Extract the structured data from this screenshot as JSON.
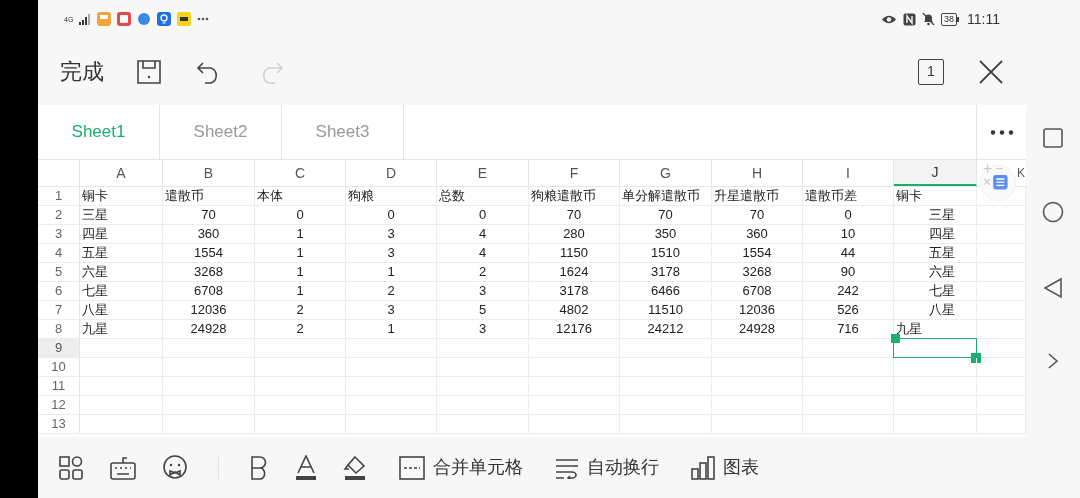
{
  "status_bar": {
    "network": "4G",
    "battery": "38",
    "time": "11:11"
  },
  "toolbar": {
    "done": "完成",
    "sheet_count": "1",
    "redo_disabled": true
  },
  "sheet_tabs": [
    {
      "label": "Sheet1",
      "selected": true
    },
    {
      "label": "Sheet2",
      "selected": false
    },
    {
      "label": "Sheet3",
      "selected": false
    }
  ],
  "columns": [
    {
      "label": "A",
      "selected": false
    },
    {
      "label": "B",
      "selected": false
    },
    {
      "label": "C",
      "selected": false
    },
    {
      "label": "D",
      "selected": false
    },
    {
      "label": "E",
      "selected": false
    },
    {
      "label": "F",
      "selected": false
    },
    {
      "label": "G",
      "selected": false
    },
    {
      "label": "H",
      "selected": false
    },
    {
      "label": "I",
      "selected": false
    },
    {
      "label": "J",
      "selected": true
    },
    {
      "label": "K",
      "selected": false
    }
  ],
  "rows": [
    {
      "number": "1",
      "selected": false,
      "cells": [
        {
          "text": "铜卡",
          "kind": "text"
        },
        {
          "text": "遣散币",
          "kind": "text"
        },
        {
          "text": "本体",
          "kind": "text"
        },
        {
          "text": "狗粮",
          "kind": "text"
        },
        {
          "text": "总数",
          "kind": "text"
        },
        {
          "text": "狗粮遣散币",
          "kind": "text"
        },
        {
          "text": "单分解遣散币",
          "kind": "text"
        },
        {
          "text": "升星遣散币",
          "kind": "text"
        },
        {
          "text": "遣散币差",
          "kind": "text"
        },
        {
          "text": "铜卡",
          "kind": "text"
        }
      ]
    },
    {
      "number": "2",
      "selected": false,
      "cells": [
        {
          "text": "三星",
          "kind": "text"
        },
        {
          "text": "70",
          "kind": "number"
        },
        {
          "text": "0",
          "kind": "number"
        },
        {
          "text": "0",
          "kind": "number"
        },
        {
          "text": "0",
          "kind": "number"
        },
        {
          "text": "70",
          "kind": "number"
        },
        {
          "text": "70",
          "kind": "number"
        },
        {
          "text": "70",
          "kind": "number"
        },
        {
          "text": "0",
          "kind": "number"
        },
        {
          "text": "三星",
          "kind": "centered_text"
        }
      ]
    },
    {
      "number": "3",
      "selected": false,
      "cells": [
        {
          "text": "四星",
          "kind": "text"
        },
        {
          "text": "360",
          "kind": "number"
        },
        {
          "text": "1",
          "kind": "number"
        },
        {
          "text": "3",
          "kind": "number"
        },
        {
          "text": "4",
          "kind": "number"
        },
        {
          "text": "280",
          "kind": "number"
        },
        {
          "text": "350",
          "kind": "number"
        },
        {
          "text": "360",
          "kind": "number"
        },
        {
          "text": "10",
          "kind": "number"
        },
        {
          "text": "四星",
          "kind": "centered_text"
        }
      ]
    },
    {
      "number": "4",
      "selected": false,
      "cells": [
        {
          "text": "五星",
          "kind": "text"
        },
        {
          "text": "1554",
          "kind": "number"
        },
        {
          "text": "1",
          "kind": "number"
        },
        {
          "text": "3",
          "kind": "number"
        },
        {
          "text": "4",
          "kind": "number"
        },
        {
          "text": "1150",
          "kind": "number"
        },
        {
          "text": "1510",
          "kind": "number"
        },
        {
          "text": "1554",
          "kind": "number"
        },
        {
          "text": "44",
          "kind": "number"
        },
        {
          "text": "五星",
          "kind": "centered_text"
        }
      ]
    },
    {
      "number": "5",
      "selected": false,
      "cells": [
        {
          "text": "六星",
          "kind": "text"
        },
        {
          "text": "3268",
          "kind": "number"
        },
        {
          "text": "1",
          "kind": "number"
        },
        {
          "text": "1",
          "kind": "number"
        },
        {
          "text": "2",
          "kind": "number"
        },
        {
          "text": "1624",
          "kind": "number"
        },
        {
          "text": "3178",
          "kind": "number"
        },
        {
          "text": "3268",
          "kind": "number"
        },
        {
          "text": "90",
          "kind": "number"
        },
        {
          "text": "六星",
          "kind": "centered_text"
        }
      ]
    },
    {
      "number": "6",
      "selected": false,
      "cells": [
        {
          "text": "七星",
          "kind": "text"
        },
        {
          "text": "6708",
          "kind": "number"
        },
        {
          "text": "1",
          "kind": "number"
        },
        {
          "text": "2",
          "kind": "number"
        },
        {
          "text": "3",
          "kind": "number"
        },
        {
          "text": "3178",
          "kind": "number"
        },
        {
          "text": "6466",
          "kind": "number"
        },
        {
          "text": "6708",
          "kind": "number"
        },
        {
          "text": "242",
          "kind": "number"
        },
        {
          "text": "七星",
          "kind": "centered_text"
        }
      ]
    },
    {
      "number": "7",
      "selected": false,
      "cells": [
        {
          "text": "八星",
          "kind": "text"
        },
        {
          "text": "12036",
          "kind": "number"
        },
        {
          "text": "2",
          "kind": "number"
        },
        {
          "text": "3",
          "kind": "number"
        },
        {
          "text": "5",
          "kind": "number"
        },
        {
          "text": "4802",
          "kind": "number"
        },
        {
          "text": "11510",
          "kind": "number"
        },
        {
          "text": "12036",
          "kind": "number"
        },
        {
          "text": "526",
          "kind": "number"
        },
        {
          "text": "八星",
          "kind": "centered_text"
        }
      ]
    },
    {
      "number": "8",
      "selected": false,
      "cells": [
        {
          "text": "九星",
          "kind": "text"
        },
        {
          "text": "24928",
          "kind": "number"
        },
        {
          "text": "2",
          "kind": "number"
        },
        {
          "text": "1",
          "kind": "number"
        },
        {
          "text": "3",
          "kind": "number"
        },
        {
          "text": "12176",
          "kind": "number"
        },
        {
          "text": "24212",
          "kind": "number"
        },
        {
          "text": "24928",
          "kind": "number"
        },
        {
          "text": "716",
          "kind": "number"
        },
        {
          "text": "九星",
          "kind": "text"
        }
      ]
    },
    {
      "number": "9",
      "selected": true,
      "cells": []
    },
    {
      "number": "10",
      "selected": false,
      "cells": []
    },
    {
      "number": "11",
      "selected": false,
      "cells": []
    },
    {
      "number": "12",
      "selected": false,
      "cells": []
    },
    {
      "number": "13",
      "selected": false,
      "cells": []
    }
  ],
  "bottom_toolbar": [
    {
      "kind": "apps"
    },
    {
      "kind": "keyboard"
    },
    {
      "kind": "sticker"
    },
    {
      "kind": "divider"
    },
    {
      "kind": "bold"
    },
    {
      "kind": "font_color"
    },
    {
      "kind": "fill_color"
    },
    {
      "kind": "merge",
      "label": "合并单元格"
    },
    {
      "kind": "wrap",
      "label": "自动换行"
    },
    {
      "kind": "chart",
      "label": "图表"
    }
  ]
}
